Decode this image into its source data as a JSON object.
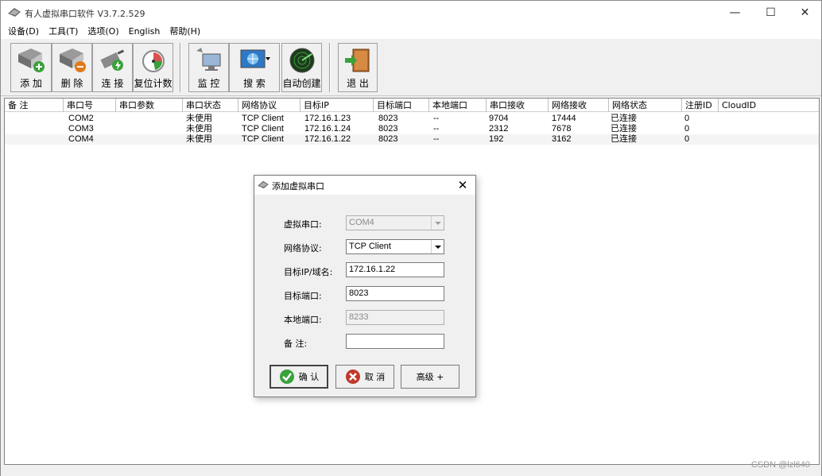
{
  "window": {
    "title": "有人虚拟串口软件 V3.7.2.529",
    "controls": {
      "minimize": "—",
      "maximize": "☐",
      "close": "✕"
    }
  },
  "menu": [
    {
      "label": "设备(D)"
    },
    {
      "label": "工具(T)"
    },
    {
      "label": "选项(O)"
    },
    {
      "label": "English"
    },
    {
      "label": "帮助(H)"
    }
  ],
  "toolbar": {
    "add": "添 加",
    "delete": "删 除",
    "connect": "连 接",
    "reset_count": "复位计数",
    "monitor": "监 控",
    "search": "搜 索",
    "auto_create": "自动创建",
    "exit": "退 出"
  },
  "table": {
    "columns": [
      "备 注",
      "串口号",
      "串口参数",
      "串口状态",
      "网络协议",
      "目标IP",
      "目标端口",
      "本地端口",
      "串口接收",
      "网络接收",
      "网络状态",
      "注册ID",
      "CloudID"
    ],
    "rows": [
      [
        "",
        "COM2",
        "",
        "未使用",
        "TCP Client",
        "172.16.1.23",
        "8023",
        "--",
        "9704",
        "17444",
        "已连接",
        "0",
        ""
      ],
      [
        "",
        "COM3",
        "",
        "未使用",
        "TCP Client",
        "172.16.1.24",
        "8023",
        "--",
        "2312",
        "7678",
        "已连接",
        "0",
        ""
      ],
      [
        "",
        "COM4",
        "",
        "未使用",
        "TCP Client",
        "172.16.1.22",
        "8023",
        "--",
        "192",
        "3162",
        "已连接",
        "0",
        ""
      ]
    ]
  },
  "dialog": {
    "title": "添加虚拟串口",
    "close": "✕",
    "labels": {
      "virtual_port": "虚拟串口:",
      "protocol": "网络协议:",
      "target_ip": "目标IP/域名:",
      "target_port": "目标端口:",
      "local_port": "本地端口:",
      "note": "备  注:"
    },
    "values": {
      "virtual_port": "COM4",
      "protocol": "TCP Client",
      "target_ip": "172.16.1.22",
      "target_port": "8023",
      "local_port": "8233",
      "note": ""
    },
    "buttons": {
      "ok": "确 认",
      "cancel": "取 消",
      "advanced": "高级 +"
    }
  },
  "watermark": "CSDN @lzl640",
  "colors": {
    "accent_green": "#3aa13a",
    "cancel_red": "#c0392b"
  }
}
